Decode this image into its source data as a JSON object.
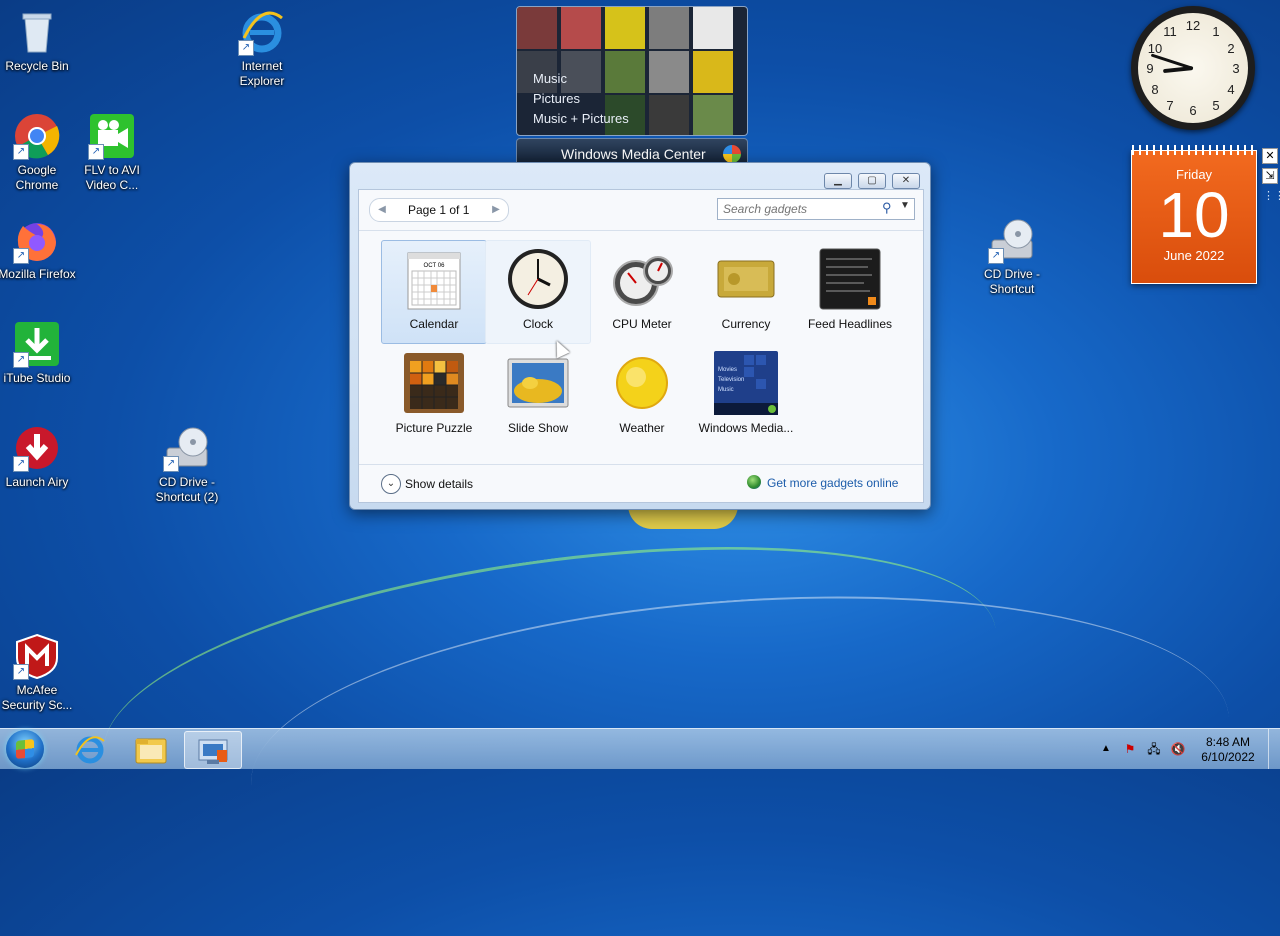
{
  "desktop": {
    "icons": [
      {
        "label": "Recycle Bin",
        "icon": "recycle-bin-icon"
      },
      {
        "label": "Internet Explorer",
        "icon": "internet-explorer-icon"
      },
      {
        "label": "Google Chrome",
        "icon": "chrome-icon"
      },
      {
        "label": "FLV to AVI Video C...",
        "icon": "video-converter-icon"
      },
      {
        "label": "Mozilla Firefox",
        "icon": "firefox-icon"
      },
      {
        "label": "iTube Studio",
        "icon": "itube-icon"
      },
      {
        "label": "Launch Airy",
        "icon": "airy-icon"
      },
      {
        "label": "CD Drive - Shortcut (2)",
        "icon": "cd-drive-icon"
      },
      {
        "label": "McAfee Security Sc...",
        "icon": "mcafee-icon"
      },
      {
        "label": "CD Drive - Shortcut",
        "icon": "cd-drive-icon"
      }
    ]
  },
  "media_center": {
    "menu": [
      "Music",
      "Pictures",
      "Music + Pictures"
    ],
    "title": "Windows Media Center"
  },
  "clock_gadget": {
    "numbers": [
      "12",
      "1",
      "2",
      "3",
      "4",
      "5",
      "6",
      "7",
      "8",
      "9",
      "10",
      "11"
    ],
    "time": "8:48"
  },
  "calendar_gadget": {
    "weekday": "Friday",
    "day": "10",
    "month_year": "June 2022"
  },
  "gallery": {
    "page_label": "Page 1 of 1",
    "search_placeholder": "Search gadgets",
    "gadgets": [
      {
        "label": "Calendar",
        "state": "selected"
      },
      {
        "label": "Clock",
        "state": "hover"
      },
      {
        "label": "CPU Meter",
        "state": "normal"
      },
      {
        "label": "Currency",
        "state": "normal"
      },
      {
        "label": "Feed Headlines",
        "state": "normal"
      },
      {
        "label": "Picture Puzzle",
        "state": "normal"
      },
      {
        "label": "Slide Show",
        "state": "normal"
      },
      {
        "label": "Weather",
        "state": "normal"
      },
      {
        "label": "Windows Media...",
        "state": "normal"
      }
    ],
    "calendar_thumb_month": "OCT 06",
    "wmc_thumb_lines": [
      "Movies",
      "Television",
      "Music"
    ],
    "show_details_label": "Show details",
    "more_gadgets_label": "Get more gadgets online"
  },
  "taskbar": {
    "time": "8:48 AM",
    "date": "6/10/2022"
  },
  "colors": {
    "accent_orange": "#e85c15",
    "link_blue": "#1d5dab",
    "selection": "#cfe2f7"
  }
}
